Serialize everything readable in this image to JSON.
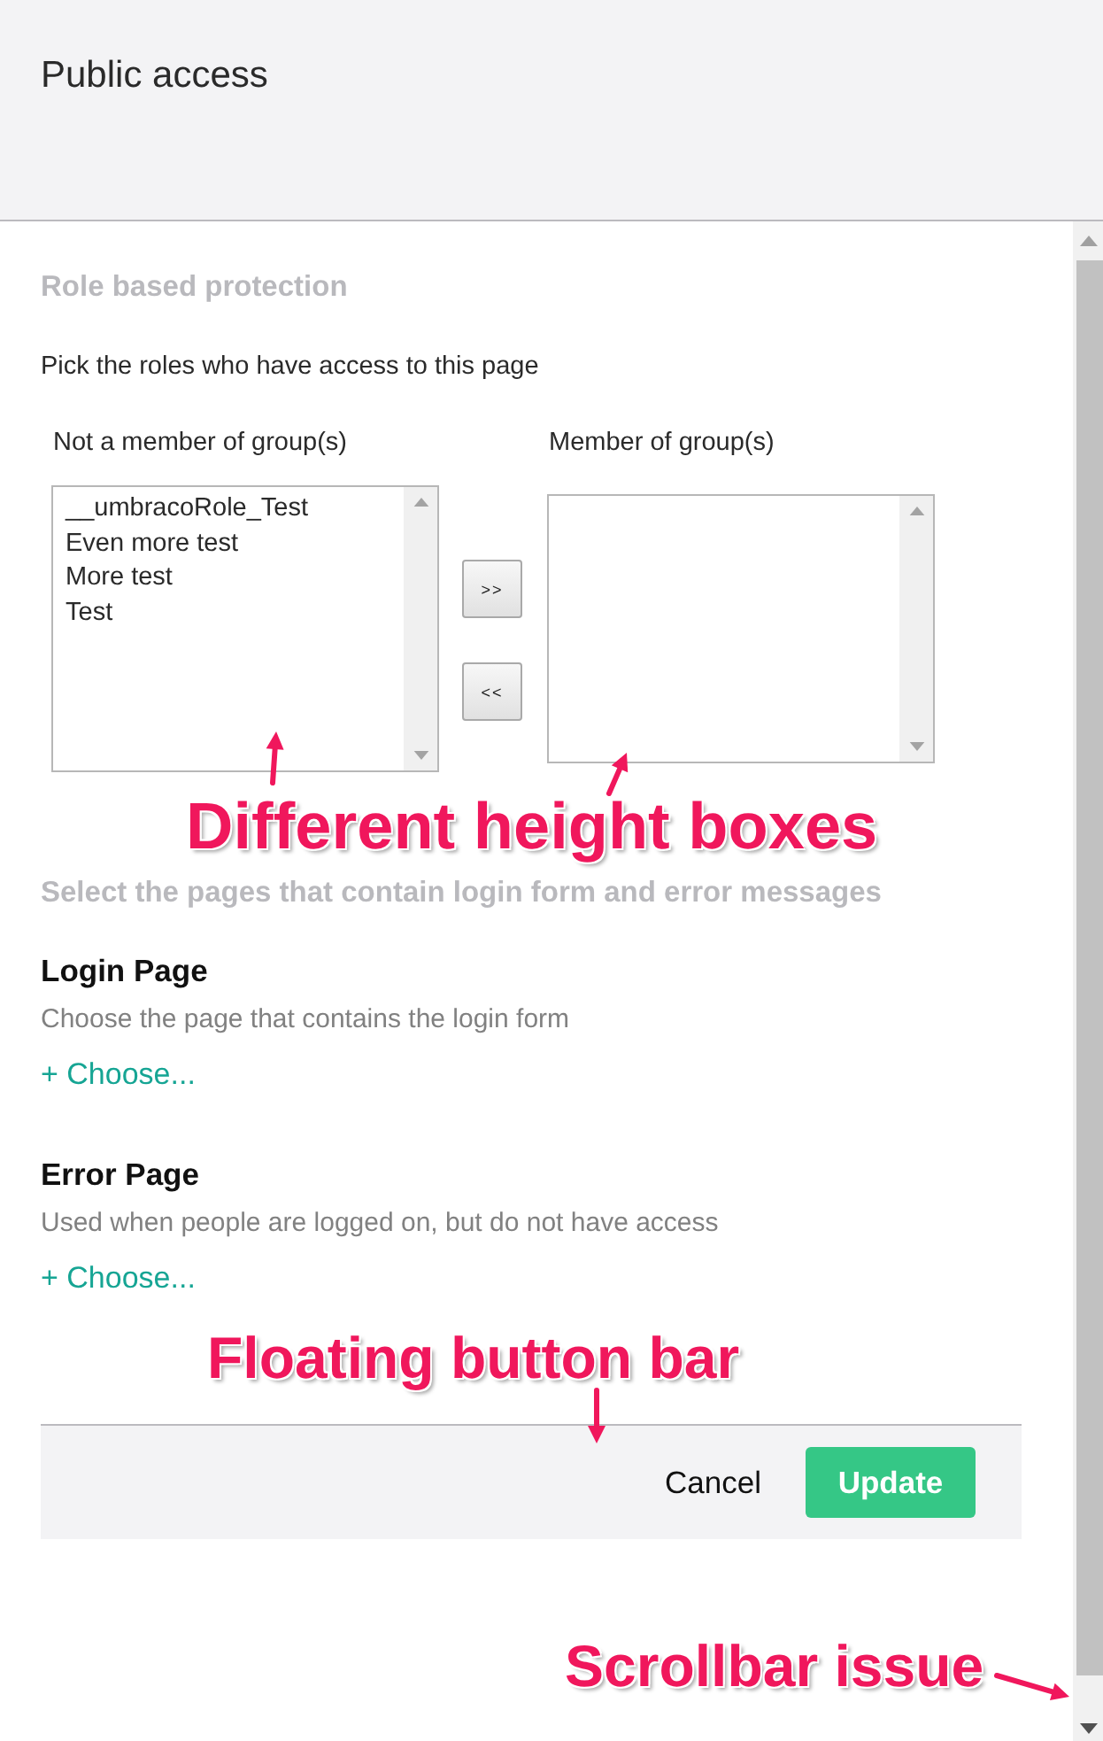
{
  "header": {
    "title": "Public access"
  },
  "roles": {
    "heading": "Role based protection",
    "instruction": "Pick the roles who have access to this page",
    "lists": [
      {
        "label": "Not a member of group(s)",
        "items": [
          {
            "text": "__umbracoRole_Test",
            "selected": false
          },
          {
            "text": "Even more test",
            "selected": false
          },
          {
            "text": "More test",
            "selected": false
          },
          {
            "text": "Test",
            "selected": false
          }
        ]
      },
      {
        "label": "Member of group(s)"
      }
    ],
    "move_buttons": [
      ">>",
      "<<"
    ]
  },
  "pages": {
    "heading": "Select the pages that contain login form and error messages",
    "pickers": [
      {
        "title": "Login Page",
        "description": "Choose the page that contains the login form",
        "action": "+ Choose..."
      },
      {
        "title": "Error Page",
        "description": "Used when people are logged on, but do not have access",
        "action": "+ Choose..."
      }
    ]
  },
  "button_bar": {
    "buttons": [
      {
        "label": "Cancel",
        "kind": "link"
      },
      {
        "label": "Update",
        "kind": "primary"
      }
    ]
  },
  "annotations": [
    {
      "text": "Different height boxes"
    },
    {
      "text": "Floating button bar"
    },
    {
      "text": "Scrollbar issue"
    }
  ]
}
